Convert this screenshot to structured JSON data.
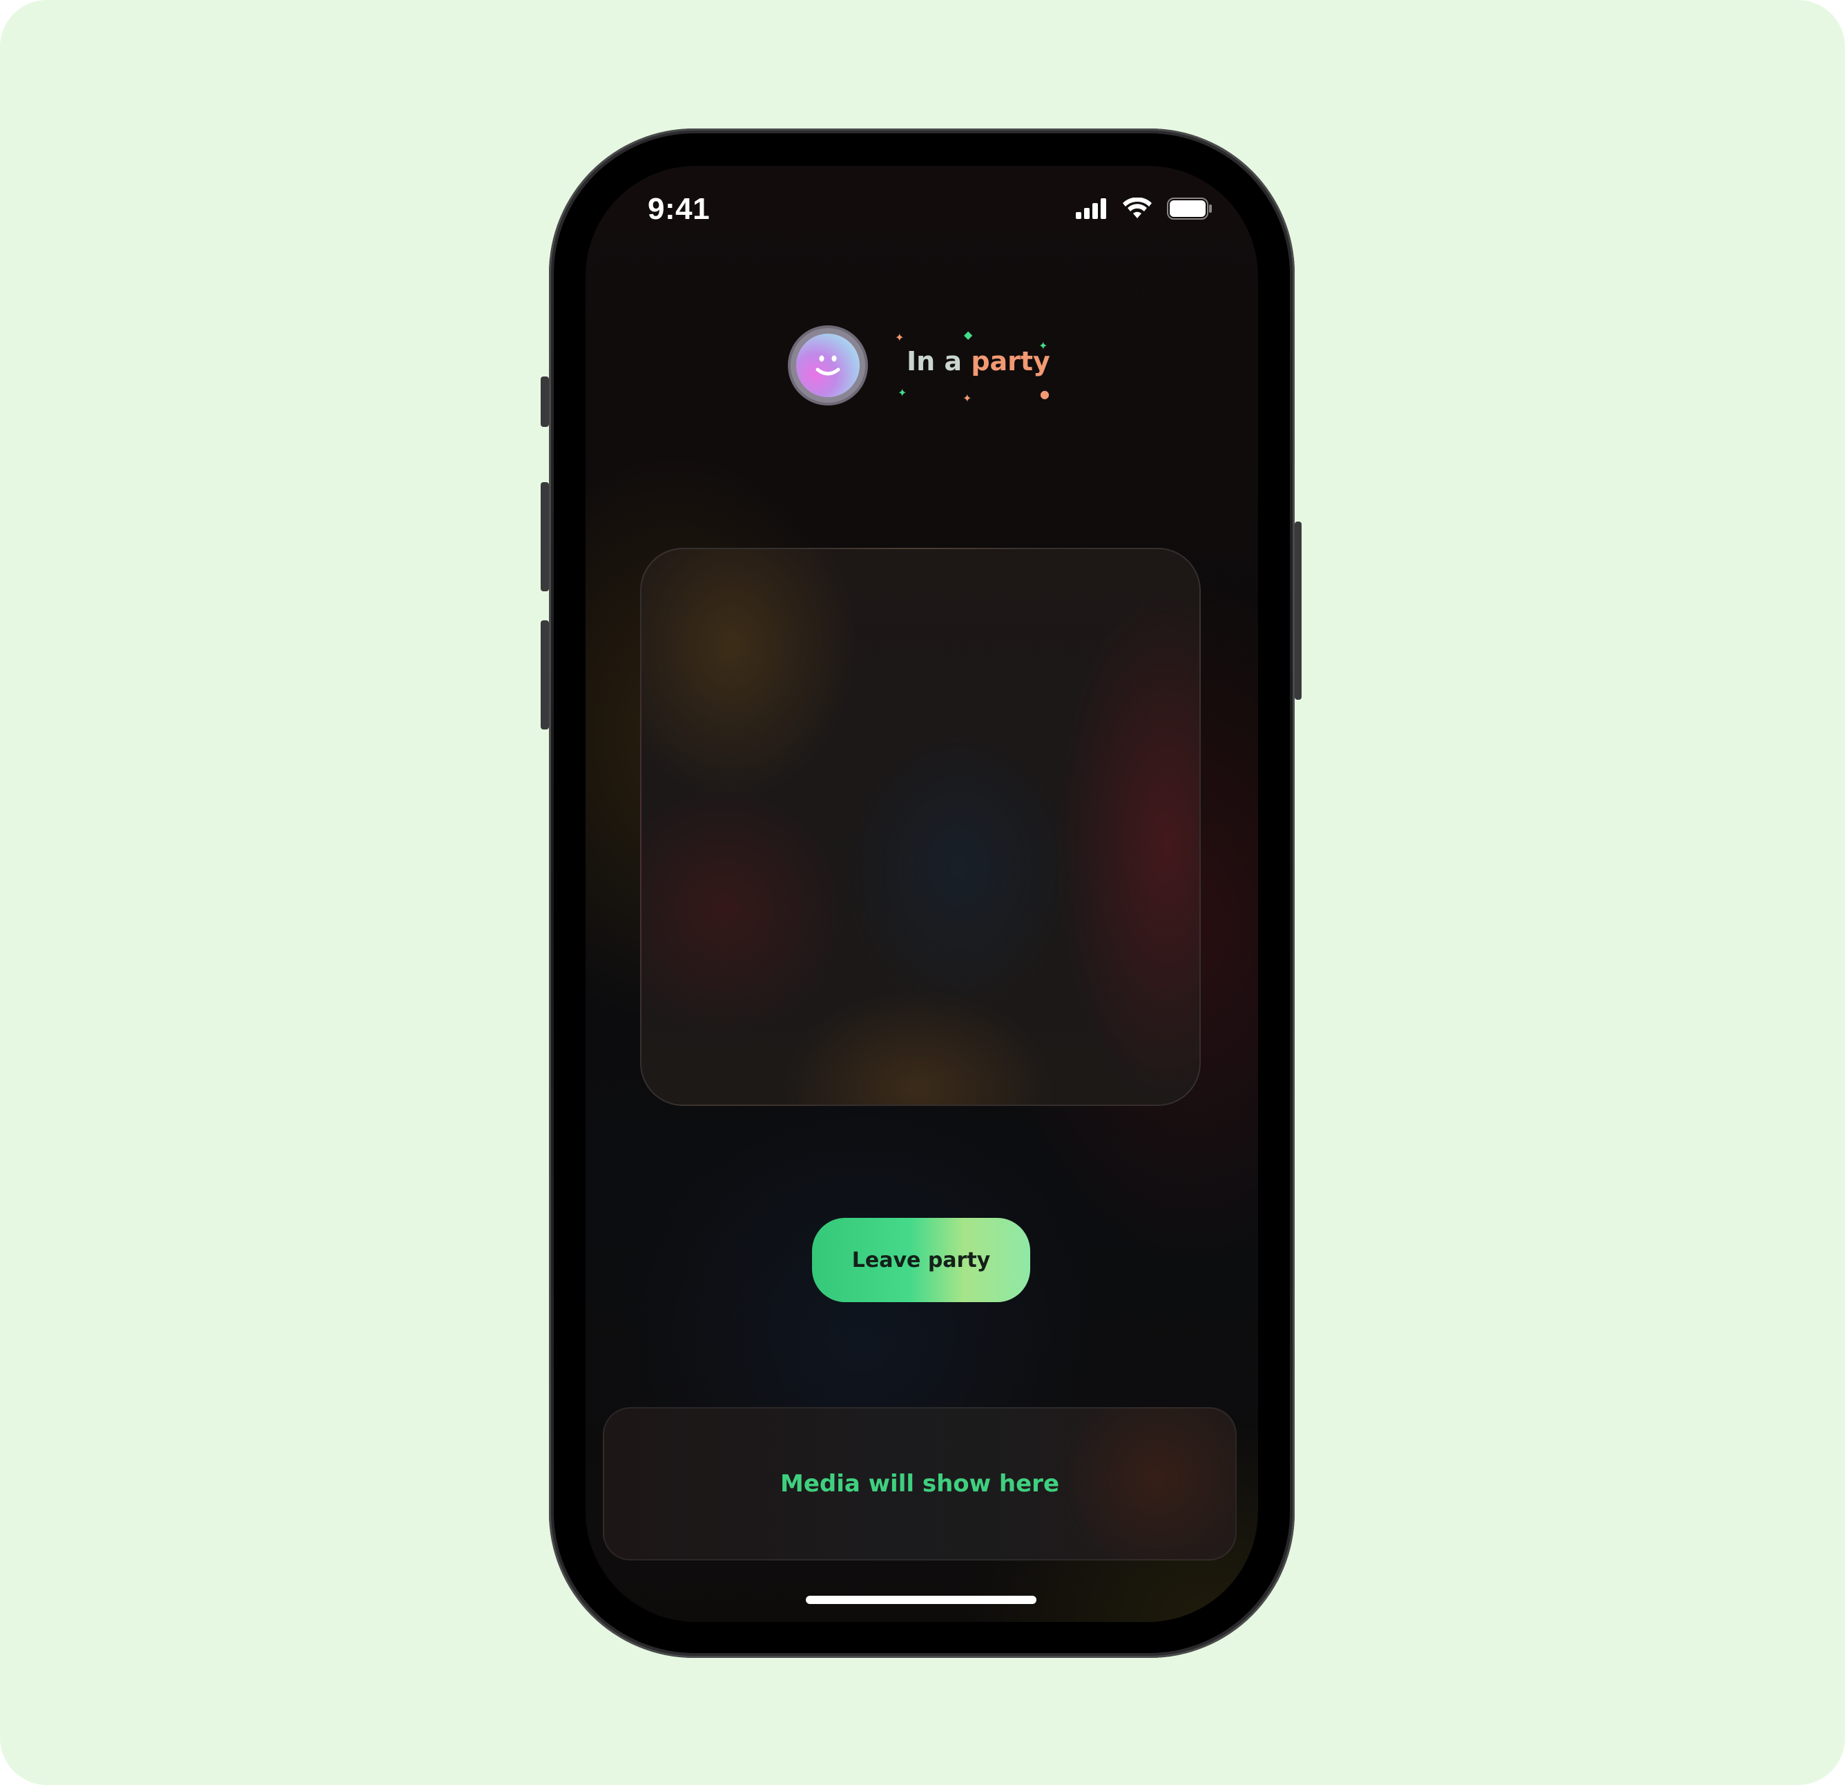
{
  "status_bar": {
    "time": "9:41",
    "icons": [
      "cellular-signal-icon",
      "wifi-icon",
      "battery-icon"
    ]
  },
  "header": {
    "avatar": "smiley-avatar",
    "label_prefix": "In a",
    "label_highlight": "party"
  },
  "media_card": {
    "state": "blurred-placeholder"
  },
  "actions": {
    "leave_label": "Leave party"
  },
  "media_bar": {
    "placeholder": "Media will show here"
  },
  "colors": {
    "backdrop": "#e6f8e1",
    "accent_green": "#3fd07f",
    "party_orange": "#f29a73",
    "screen_bg": "#0d0b0b"
  }
}
